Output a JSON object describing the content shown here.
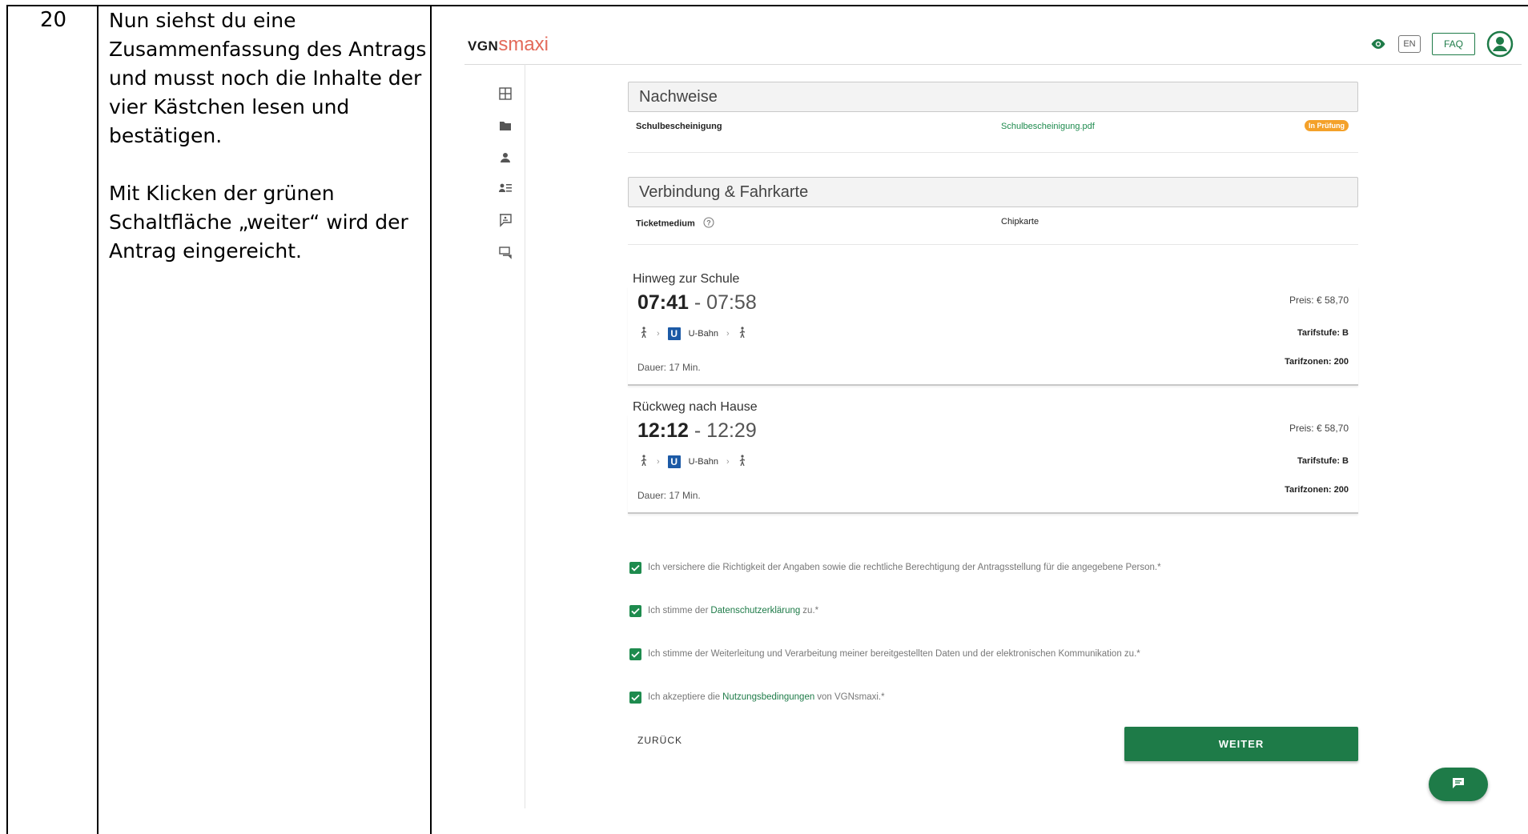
{
  "step": {
    "number": "20"
  },
  "instructions": {
    "para1": "Nun siehst du eine Zusammenfassung des Antrags und musst noch die Inhalte der vier Kästchen lesen und bestätigen.",
    "para2": "Mit Klicken der grünen Schaltfläche „weiter“ wird der Antrag eingereicht."
  },
  "header": {
    "logo_vgn": "VGN",
    "logo_smaxi": "smaxi",
    "lang_label": "EN",
    "faq_label": "FAQ"
  },
  "nachweise": {
    "title": "Nachweise",
    "label": "Schulbescheinigung",
    "file": "Schulbescheinigung.pdf",
    "status": "In Prüfung"
  },
  "verbindung": {
    "title": "Verbindung & Fahrkarte",
    "ticket_label": "Ticketmedium",
    "ticket_value": "Chipkarte"
  },
  "hinweg": {
    "title": "Hinweg zur Schule",
    "depart": "07:41",
    "separator": " - ",
    "arrive": "07:58",
    "mode": "U-Bahn",
    "duration": "Dauer: 17 Min.",
    "price": "Preis: € 58,70",
    "tarifstufe": "Tarifstufe: B",
    "tarifzonen": "Tarifzonen: 200"
  },
  "rueckweg": {
    "title": "Rückweg nach Hause",
    "depart": "12:12",
    "separator": " - ",
    "arrive": "12:29",
    "mode": "U-Bahn",
    "duration": "Dauer: 17 Min.",
    "price": "Preis: € 58,70",
    "tarifstufe": "Tarifstufe: B",
    "tarifzonen": "Tarifzonen: 200"
  },
  "checks": {
    "c1": "Ich versichere die Richtigkeit der Angaben sowie die rechtliche Berechtigung der Antragsstellung für die angegebene Person.*",
    "c2_pre": "Ich stimme der",
    "c2_link": "Datenschutzerklärung",
    "c2_post": "zu.*",
    "c3": "Ich stimme der Weiterleitung und Verarbeitung meiner bereitgestellten Daten und der elektronischen Kommunikation zu.*",
    "c4_pre": "Ich akzeptiere die",
    "c4_link": "Nutzungsbedingungen",
    "c4_post": "von VGNsmaxi.*"
  },
  "buttons": {
    "back": "ZURÜCK",
    "next": "WEITER"
  },
  "colors": {
    "brand_green": "#1e7b48",
    "status_orange": "#f4a12a",
    "ubahn_blue": "#1c5aa6"
  }
}
